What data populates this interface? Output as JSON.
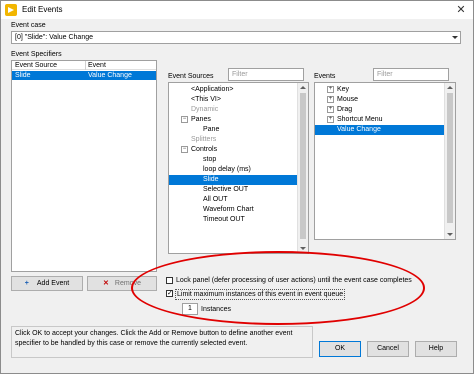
{
  "window": {
    "title": "Edit Events",
    "close_glyph": "✕"
  },
  "event_case": {
    "label": "Event case",
    "selected": "[0] \"Slide\": Value Change"
  },
  "event_specifiers": {
    "label": "Event Specifiers",
    "columns": [
      "Event Source",
      "Event"
    ],
    "rows": [
      {
        "source": "Slide",
        "event": "Value Change",
        "selected": true
      }
    ]
  },
  "event_sources": {
    "label": "Event Sources",
    "filter_placeholder": "Filter",
    "items": [
      {
        "text": "<Application>",
        "level": 1,
        "expander": "",
        "disabled": false,
        "selected": false
      },
      {
        "text": "<This VI>",
        "level": 1,
        "expander": "",
        "disabled": false,
        "selected": false
      },
      {
        "text": "Dynamic",
        "level": 1,
        "expander": "",
        "disabled": true,
        "selected": false
      },
      {
        "text": "Panes",
        "level": 1,
        "expander": "−",
        "disabled": false,
        "selected": false
      },
      {
        "text": "Pane",
        "level": 2,
        "expander": "",
        "disabled": false,
        "selected": false
      },
      {
        "text": "Splitters",
        "level": 1,
        "expander": "",
        "disabled": true,
        "selected": false
      },
      {
        "text": "Controls",
        "level": 1,
        "expander": "−",
        "disabled": false,
        "selected": false
      },
      {
        "text": "stop",
        "level": 2,
        "expander": "",
        "disabled": false,
        "selected": false
      },
      {
        "text": "loop delay (ms)",
        "level": 2,
        "expander": "",
        "disabled": false,
        "selected": false
      },
      {
        "text": "Slide",
        "level": 2,
        "expander": "",
        "disabled": false,
        "selected": true
      },
      {
        "text": "Selective OUT",
        "level": 2,
        "expander": "",
        "disabled": false,
        "selected": false
      },
      {
        "text": "All OUT",
        "level": 2,
        "expander": "",
        "disabled": false,
        "selected": false
      },
      {
        "text": "Waveform Chart",
        "level": 2,
        "expander": "",
        "disabled": false,
        "selected": false
      },
      {
        "text": "Timeout OUT",
        "level": 2,
        "expander": "",
        "disabled": false,
        "selected": false
      }
    ]
  },
  "events": {
    "label": "Events",
    "filter_placeholder": "Filter",
    "items": [
      {
        "text": "Key",
        "expander": "+",
        "selected": false
      },
      {
        "text": "Mouse",
        "expander": "+",
        "selected": false
      },
      {
        "text": "Drag",
        "expander": "+",
        "selected": false
      },
      {
        "text": "Shortcut Menu",
        "expander": "+",
        "selected": false
      },
      {
        "text": "Value Change",
        "expander": "",
        "selected": true
      }
    ]
  },
  "buttons": {
    "add_event": "Add Event",
    "add_glyph": "+",
    "remove": "Remove",
    "remove_glyph": "✕",
    "ok": "OK",
    "cancel": "Cancel",
    "help": "Help"
  },
  "options": {
    "lock_panel": {
      "label": "Lock panel (defer processing of user actions) until the event case completes",
      "checked": false
    },
    "limit_instances": {
      "label": "Limit maximum instances of this event in event queue",
      "checked": true,
      "check_glyph": "✓"
    },
    "instances": {
      "value": "1",
      "label": "Instances"
    }
  },
  "help_text": "Click OK to accept your changes.  Click the Add or Remove button to define another event specifier to be handled by this case or remove the currently selected event.",
  "colors": {
    "selection": "#0078d7",
    "annotation_oval": "#e00000"
  }
}
